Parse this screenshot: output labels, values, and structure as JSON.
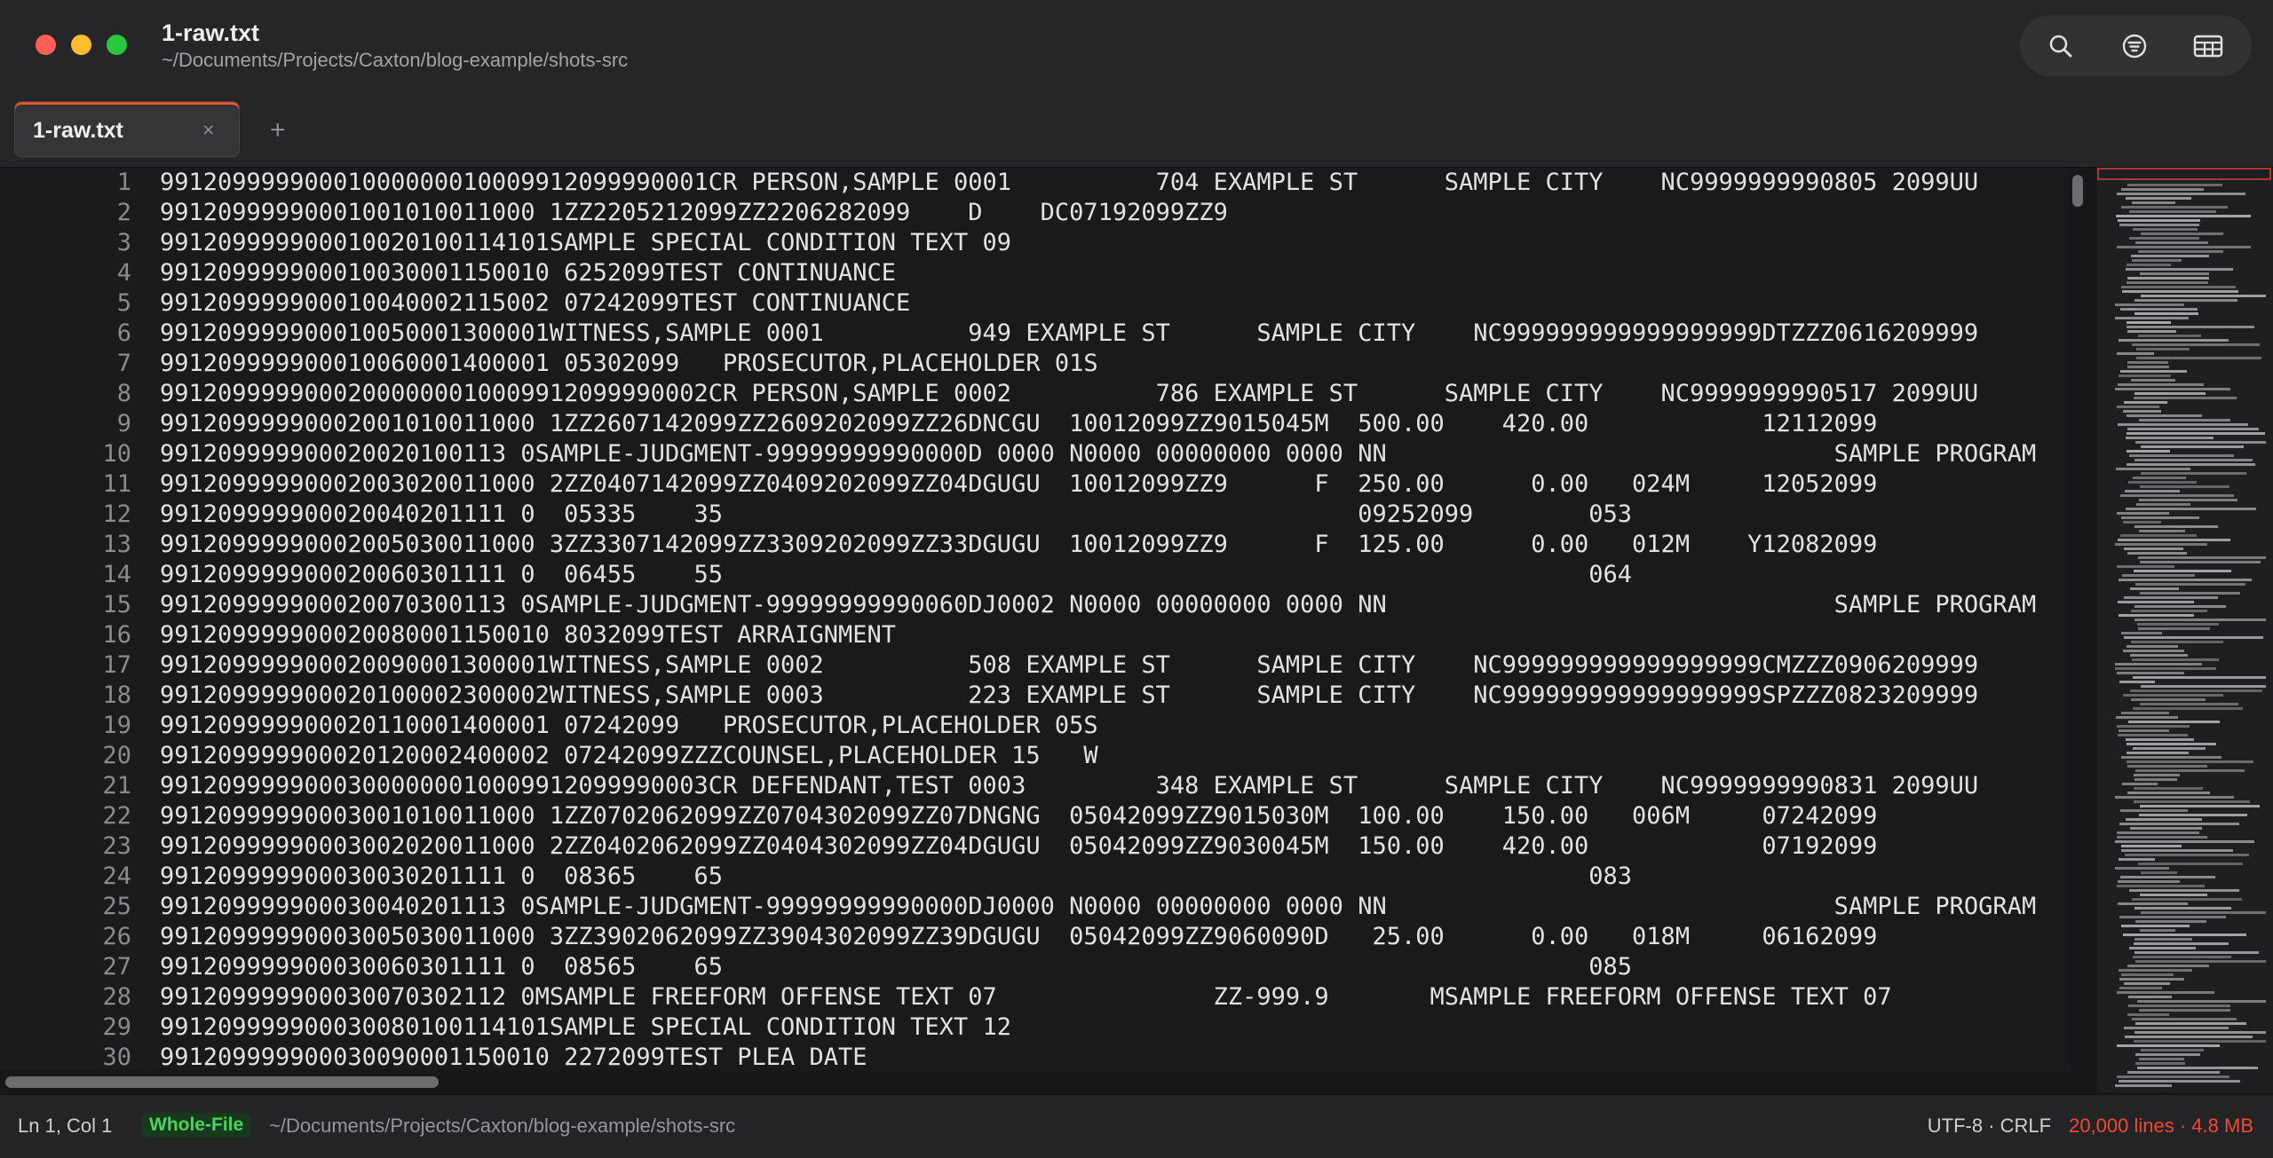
{
  "window": {
    "title": "1-raw.txt",
    "path": "~/Documents/Projects/Caxton/blog-example/shots-src"
  },
  "toolbar": {
    "icons": [
      "search-icon",
      "filter-icon",
      "table-icon"
    ]
  },
  "tabs": [
    {
      "label": "1-raw.txt",
      "close_glyph": "×",
      "active": true
    }
  ],
  "new_tab_glyph": "+",
  "editor": {
    "lines": [
      {
        "num": "1",
        "text": "99120999990001000000010009912099990001CR PERSON,SAMPLE 0001          704 EXAMPLE ST      SAMPLE CITY    NC9999999990805 2099UU"
      },
      {
        "num": "2",
        "text": "99120999990001001010011000 1ZZ2205212099ZZ2206282099    D    DC07192099ZZ9"
      },
      {
        "num": "3",
        "text": "991209999900010020100114101SAMPLE SPECIAL CONDITION TEXT 09"
      },
      {
        "num": "4",
        "text": "991209999900010030001150010 6252099TEST CONTINUANCE"
      },
      {
        "num": "5",
        "text": "991209999900010040002115002 07242099TEST CONTINUANCE"
      },
      {
        "num": "6",
        "text": "991209999900010050001300001WITNESS,SAMPLE 0001          949 EXAMPLE ST      SAMPLE CITY    NC999999999999999999DTZZZ0616209999"
      },
      {
        "num": "7",
        "text": "991209999900010060001400001 05302099   PROSECUTOR,PLACEHOLDER 01S"
      },
      {
        "num": "8",
        "text": "99120999990002000000010009912099990002CR PERSON,SAMPLE 0002          786 EXAMPLE ST      SAMPLE CITY    NC9999999990517 2099UU"
      },
      {
        "num": "9",
        "text": "99120999990002001010011000 1ZZ2607142099ZZ2609202099ZZ26DNCGU  10012099ZZ9015045M  500.00    420.00            12112099"
      },
      {
        "num": "10",
        "text": "991209999900020020100113 0SAMPLE-JUDGMENT-99999999990000D 0000 N0000 00000000 0000 NN                               SAMPLE PROGRAM"
      },
      {
        "num": "11",
        "text": "99120999990002003020011000 2ZZ0407142099ZZ0409202099ZZ04DGUGU  10012099ZZ9      F  250.00      0.00   024M     12052099"
      },
      {
        "num": "12",
        "text": "991209999900020040201111 0  05335    35                                            09252099        053"
      },
      {
        "num": "13",
        "text": "99120999990002005030011000 3ZZ3307142099ZZ3309202099ZZ33DGUGU  10012099ZZ9      F  125.00      0.00   012M    Y12082099"
      },
      {
        "num": "14",
        "text": "991209999900020060301111 0  06455    55                                                            064"
      },
      {
        "num": "15",
        "text": "991209999900020070300113 0SAMPLE-JUDGMENT-99999999990060DJ0002 N0000 00000000 0000 NN                               SAMPLE PROGRAM"
      },
      {
        "num": "16",
        "text": "991209999900020080001150010 8032099TEST ARRAIGNMENT"
      },
      {
        "num": "17",
        "text": "991209999900020090001300001WITNESS,SAMPLE 0002          508 EXAMPLE ST      SAMPLE CITY    NC999999999999999999CMZZZ0906209999"
      },
      {
        "num": "18",
        "text": "991209999900020100002300002WITNESS,SAMPLE 0003          223 EXAMPLE ST      SAMPLE CITY    NC999999999999999999SPZZZ0823209999"
      },
      {
        "num": "19",
        "text": "991209999900020110001400001 07242099   PROSECUTOR,PLACEHOLDER 05S"
      },
      {
        "num": "20",
        "text": "991209999900020120002400002 07242099ZZZCOUNSEL,PLACEHOLDER 15   W"
      },
      {
        "num": "21",
        "text": "99120999990003000000010009912099990003CR DEFENDANT,TEST 0003         348 EXAMPLE ST      SAMPLE CITY    NC9999999990831 2099UU"
      },
      {
        "num": "22",
        "text": "99120999990003001010011000 1ZZ0702062099ZZ0704302099ZZ07DNGNG  05042099ZZ9015030M  100.00    150.00   006M     07242099"
      },
      {
        "num": "23",
        "text": "99120999990003002020011000 2ZZ0402062099ZZ0404302099ZZ04DGUGU  05042099ZZ9030045M  150.00    420.00            07192099"
      },
      {
        "num": "24",
        "text": "991209999900030030201111 0  08365    65                                                            083"
      },
      {
        "num": "25",
        "text": "991209999900030040201113 0SAMPLE-JUDGMENT-99999999990000DJ0000 N0000 00000000 0000 NN                               SAMPLE PROGRAM"
      },
      {
        "num": "26",
        "text": "99120999990003005030011000 3ZZ3902062099ZZ3904302099ZZ39DGUGU  05042099ZZ9060090D   25.00      0.00   018M     06162099"
      },
      {
        "num": "27",
        "text": "991209999900030060301111 0  08565    65                                                            085"
      },
      {
        "num": "28",
        "text": "991209999900030070302112 0MSAMPLE FREEFORM OFFENSE TEXT 07               ZZ-999.9       MSAMPLE FREEFORM OFFENSE TEXT 07"
      },
      {
        "num": "29",
        "text": "991209999900030080100114101SAMPLE SPECIAL CONDITION TEXT 12"
      },
      {
        "num": "30",
        "text": "991209999900030090001150010 2272099TEST PLEA DATE"
      }
    ]
  },
  "status": {
    "cursor": "Ln 1, Col 1",
    "mode_badge": "Whole-File",
    "path": "~/Documents/Projects/Caxton/blog-example/shots-src",
    "encoding": "UTF-8 · CRLF",
    "size": "20,000 lines · 4.8 MB"
  },
  "colors": {
    "accent": "#e2562b",
    "badge_bg": "#173a1d",
    "badge_text": "#4fd160",
    "size_text": "#ef4a33"
  }
}
